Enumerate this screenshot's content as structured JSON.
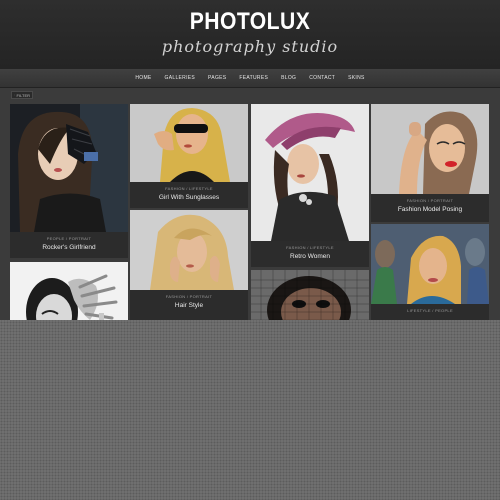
{
  "site": {
    "title": "PHOTOLUX",
    "tagline": "photography studio"
  },
  "nav": {
    "items": [
      "HOME",
      "GALLERIES",
      "PAGES",
      "FEATURES",
      "BLOG",
      "CONTACT",
      "SKINS"
    ]
  },
  "filter": {
    "label": "FILTER",
    "icon": "filter-icon"
  },
  "gallery": {
    "items": [
      {
        "category": "PEOPLE / PORTRAIT",
        "title": "Rocker's Girlfriend"
      },
      {
        "category": "FASHION / LIFESTYLE",
        "title": "Girl With Sunglasses"
      },
      {
        "category": "FASHION / LIFESTYLE",
        "title": "Retro Women"
      },
      {
        "category": "FASHION / PORTRAIT",
        "title": "Fashion Model Posing"
      },
      {
        "category": "FASHION / PORTRAIT",
        "title": "Hair Style"
      },
      {
        "category": "LIFESTYLE / PEOPLE",
        "title": ""
      }
    ]
  },
  "colors": {
    "header": "#2a2a2a",
    "nav": "#3a3a3a",
    "content": "#3b3b3b",
    "card": "#2c2c2c",
    "page_background": "#6b6b6b"
  }
}
